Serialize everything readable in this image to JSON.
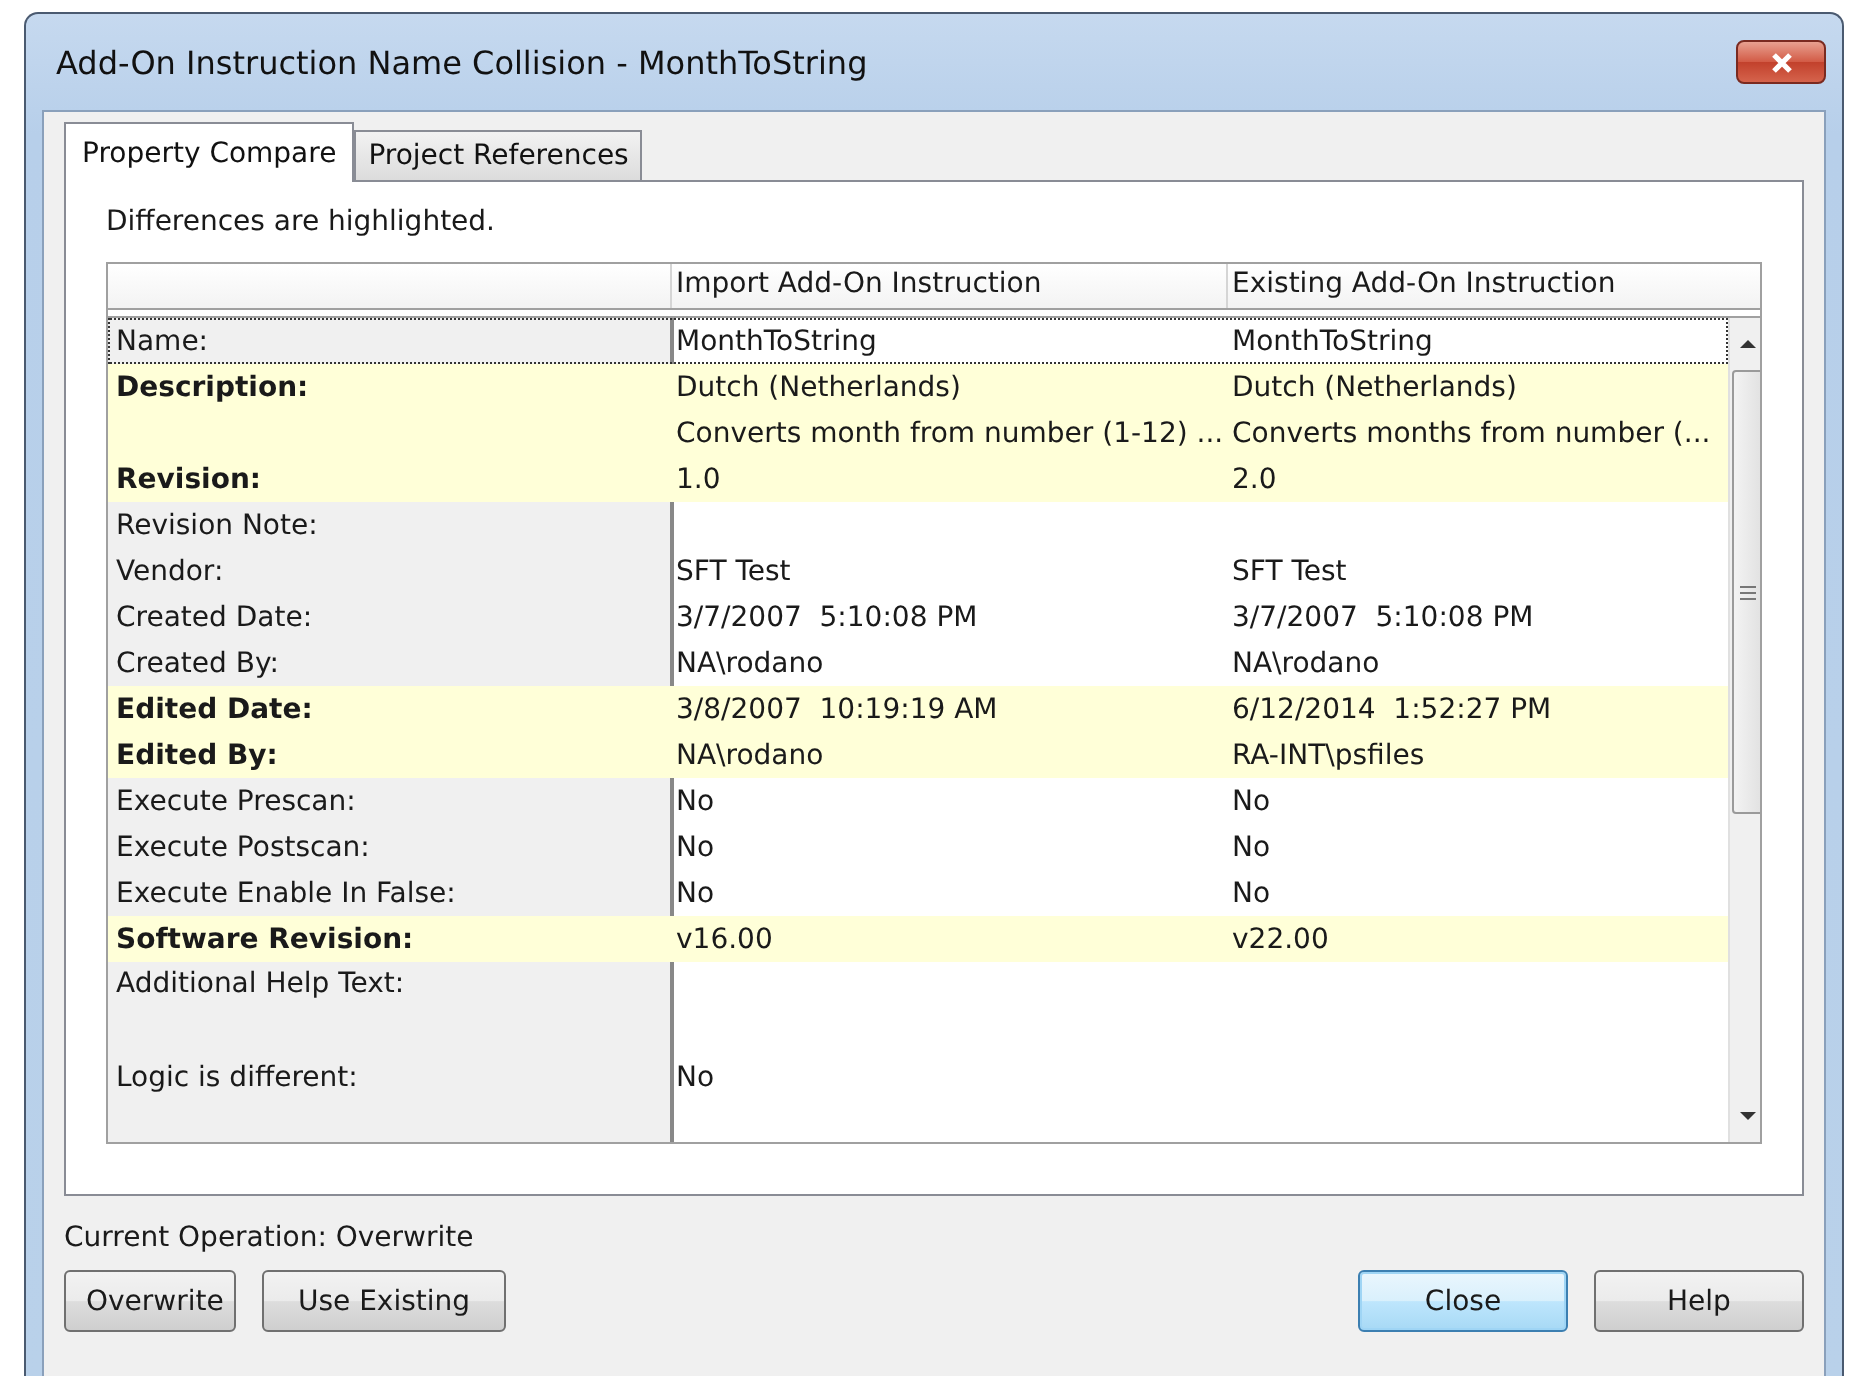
{
  "window": {
    "title": "Add-On Instruction Name Collision - MonthToString"
  },
  "tabs": [
    {
      "label": "Property Compare",
      "selected": true
    },
    {
      "label": "Project References",
      "selected": false
    }
  ],
  "hint": "Differences are highlighted.",
  "table": {
    "columns": [
      "Import Add-On Instruction",
      "Existing Add-On Instruction"
    ],
    "rows": [
      {
        "label": "Name:",
        "import": "MonthToString",
        "existing": "MonthToString",
        "highlighted": false,
        "selected": true,
        "tall": false
      },
      {
        "label": "Description:",
        "import": "Dutch (Netherlands)",
        "existing": "Dutch (Netherlands)",
        "highlighted": true,
        "selected": false,
        "tall": false
      },
      {
        "label": "",
        "import": "Converts month from number (1-12) ...",
        "existing": "Converts months from number (...",
        "highlighted": true,
        "selected": false,
        "tall": false
      },
      {
        "label": "Revision:",
        "import": "1.0",
        "existing": "2.0",
        "highlighted": true,
        "selected": false,
        "tall": false
      },
      {
        "label": "Revision Note:",
        "import": "",
        "existing": "",
        "highlighted": false,
        "selected": false,
        "tall": false
      },
      {
        "label": "Vendor:",
        "import": "SFT Test",
        "existing": "SFT Test",
        "highlighted": false,
        "selected": false,
        "tall": false
      },
      {
        "label": "Created Date:",
        "import": "3/7/2007  5:10:08 PM",
        "existing": "3/7/2007  5:10:08 PM",
        "highlighted": false,
        "selected": false,
        "tall": false
      },
      {
        "label": "Created By:",
        "import": "NA\\rodano",
        "existing": "NA\\rodano",
        "highlighted": false,
        "selected": false,
        "tall": false
      },
      {
        "label": "Edited Date:",
        "import": "3/8/2007  10:19:19 AM",
        "existing": "6/12/2014  1:52:27 PM",
        "highlighted": true,
        "selected": false,
        "tall": false
      },
      {
        "label": "Edited By:",
        "import": "NA\\rodano",
        "existing": "RA-INT\\psfiles",
        "highlighted": true,
        "selected": false,
        "tall": false
      },
      {
        "label": "Execute Prescan:",
        "import": "No",
        "existing": "No",
        "highlighted": false,
        "selected": false,
        "tall": false
      },
      {
        "label": "Execute Postscan:",
        "import": "No",
        "existing": "No",
        "highlighted": false,
        "selected": false,
        "tall": false
      },
      {
        "label": "Execute Enable In False:",
        "import": "No",
        "existing": "No",
        "highlighted": false,
        "selected": false,
        "tall": false
      },
      {
        "label": "Software Revision:",
        "import": "v16.00",
        "existing": "v22.00",
        "highlighted": true,
        "selected": false,
        "tall": false
      },
      {
        "label": "Additional Help Text:",
        "import": "",
        "existing": "",
        "highlighted": false,
        "selected": false,
        "tall": true
      },
      {
        "label": "Logic is different:",
        "import": "No",
        "existing": "",
        "highlighted": false,
        "selected": false,
        "tall": false
      }
    ]
  },
  "status": "Current Operation: Overwrite",
  "buttons_left": [
    {
      "label": "Overwrite",
      "default": false
    },
    {
      "label": "Use Existing",
      "default": false
    }
  ],
  "buttons_right": [
    {
      "label": "Close",
      "default": true
    },
    {
      "label": "Help",
      "default": false
    }
  ]
}
